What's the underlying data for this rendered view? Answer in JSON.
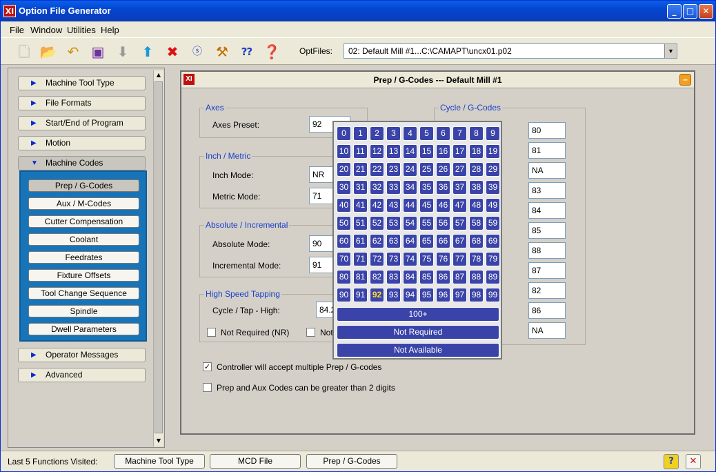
{
  "window": {
    "title": "Option File Generator",
    "logo": "XI"
  },
  "menu": [
    "File",
    "Window",
    "Utilities",
    "Help"
  ],
  "toolbar": {
    "icons": [
      "new-file-icon",
      "open-folder-icon",
      "undo-icon",
      "save-icon",
      "down-arrow-icon",
      "up-arrow-icon",
      "delete-icon",
      "script-icon",
      "tools-icon",
      "context-help-icon",
      "help-icon"
    ],
    "optfiles_label": "OptFiles:",
    "optfiles_value": "02:  Default Mill #1...C:\\CAMAPT\\uncx01.p02"
  },
  "nav": {
    "items": [
      "Machine Tool Type",
      "File Formats",
      "Start/End of Program",
      "Motion",
      "Machine Codes",
      "Operator Messages",
      "Advanced"
    ],
    "sub_items": [
      "Prep / G-Codes",
      "Aux / M-Codes",
      "Cutter Compensation",
      "Coolant",
      "Feedrates",
      "Fixture Offsets",
      "Tool Change Sequence",
      "Spindle",
      "Dwell Parameters"
    ],
    "selected_sub": "Prep / G-Codes"
  },
  "panel": {
    "title": "Prep / G-Codes --- Default Mill #1",
    "axes": {
      "title": "Axes",
      "preset_label": "Axes Preset:",
      "preset_value": "92"
    },
    "inch_metric": {
      "title": "Inch / Metric",
      "inch_label": "Inch Mode:",
      "inch_value": "NR",
      "metric_label": "Metric Mode:",
      "metric_value": "71"
    },
    "abs_inc": {
      "title": "Absolute / Incremental",
      "abs_label": "Absolute Mode:",
      "abs_value": "90",
      "inc_label": "Incremental Mode:",
      "inc_value": "91"
    },
    "hst": {
      "title": "High Speed Tapping",
      "cycle_label": "Cycle / Tap - High:",
      "cycle_value": "84.2",
      "nr_label": "Not Required (NR)",
      "na_label": "Not"
    },
    "cycle": {
      "title": "Cycle / G-Codes",
      "values": [
        "80",
        "81",
        "NA",
        "83",
        "84",
        "85",
        "88",
        "87",
        "82",
        "86",
        "NA"
      ]
    },
    "check1": "Controller will accept multiple Prep / G-codes",
    "check2": "Prep and Aux Codes can be greater than 2 digits"
  },
  "popup": {
    "numbers": [
      "0",
      "1",
      "2",
      "3",
      "4",
      "5",
      "6",
      "7",
      "8",
      "9",
      "10",
      "11",
      "12",
      "13",
      "14",
      "15",
      "16",
      "17",
      "18",
      "19",
      "20",
      "21",
      "22",
      "23",
      "24",
      "25",
      "26",
      "27",
      "28",
      "29",
      "30",
      "31",
      "32",
      "33",
      "34",
      "35",
      "36",
      "37",
      "38",
      "39",
      "40",
      "41",
      "42",
      "43",
      "44",
      "45",
      "46",
      "47",
      "48",
      "49",
      "50",
      "51",
      "52",
      "53",
      "54",
      "55",
      "56",
      "57",
      "58",
      "59",
      "60",
      "61",
      "62",
      "63",
      "64",
      "65",
      "66",
      "67",
      "68",
      "69",
      "70",
      "71",
      "72",
      "73",
      "74",
      "75",
      "76",
      "77",
      "78",
      "79",
      "80",
      "81",
      "82",
      "83",
      "84",
      "85",
      "86",
      "87",
      "88",
      "89",
      "90",
      "91",
      "92",
      "93",
      "94",
      "95",
      "96",
      "97",
      "98",
      "99"
    ],
    "selected": "92",
    "more_label": "100+",
    "nr_label": "Not Required",
    "na_label": "Not Available"
  },
  "status": {
    "label": "Last 5 Functions Visited:",
    "buttons": [
      "Machine Tool Type",
      "MCD File",
      "Prep / G-Codes"
    ]
  }
}
